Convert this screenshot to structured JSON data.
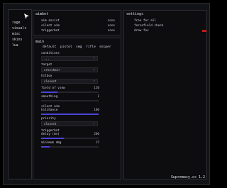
{
  "sidebar": {
    "items": [
      "rage",
      "visuals",
      "misc",
      "skins",
      "lua"
    ]
  },
  "aimbot": {
    "title": "aimbot",
    "rows": [
      {
        "label": "aim assist",
        "value": "none"
      },
      {
        "label": "silent aim",
        "value": "none"
      },
      {
        "label": "triggerbot",
        "value": "none"
      }
    ]
  },
  "settings": {
    "title": "settings",
    "rows": [
      {
        "label": "free for all",
        "active": false
      },
      {
        "label": "forcefield check",
        "active": false
      },
      {
        "label": "draw fov",
        "active": true
      }
    ]
  },
  "main": {
    "title": "main",
    "tabs": [
      "default",
      "pistol",
      "smg",
      "rifle",
      "sniper"
    ],
    "conditions": {
      "label": "conditions",
      "value": "..."
    },
    "target": {
      "label": "target",
      "value": "crosshair"
    },
    "hitbox": {
      "label": "hitbox",
      "value": "closest"
    },
    "field_of_view": {
      "label": "field of view",
      "value": "120",
      "fill": 0.28
    },
    "smoothing": {
      "label": "smoothing",
      "value": "1",
      "fill": 0.0
    },
    "silent_aim_hitchance": {
      "label1": "silent aim",
      "label2": "hitchance",
      "value": "100",
      "fill": 1.0
    },
    "priority": {
      "label": "priority",
      "value": "closest"
    },
    "triggerbot_delay": {
      "label1": "triggerbot",
      "label2": "delay (ms)",
      "value": "200",
      "fill": 0.4
    },
    "minimum_dmg": {
      "label": "minimum dmg",
      "value": "15",
      "fill": 0.15
    }
  },
  "footer": {
    "brand": "Supremacy.cc 1.2"
  },
  "colors": {
    "accent": "#4b44d6",
    "active": "#c81616"
  }
}
